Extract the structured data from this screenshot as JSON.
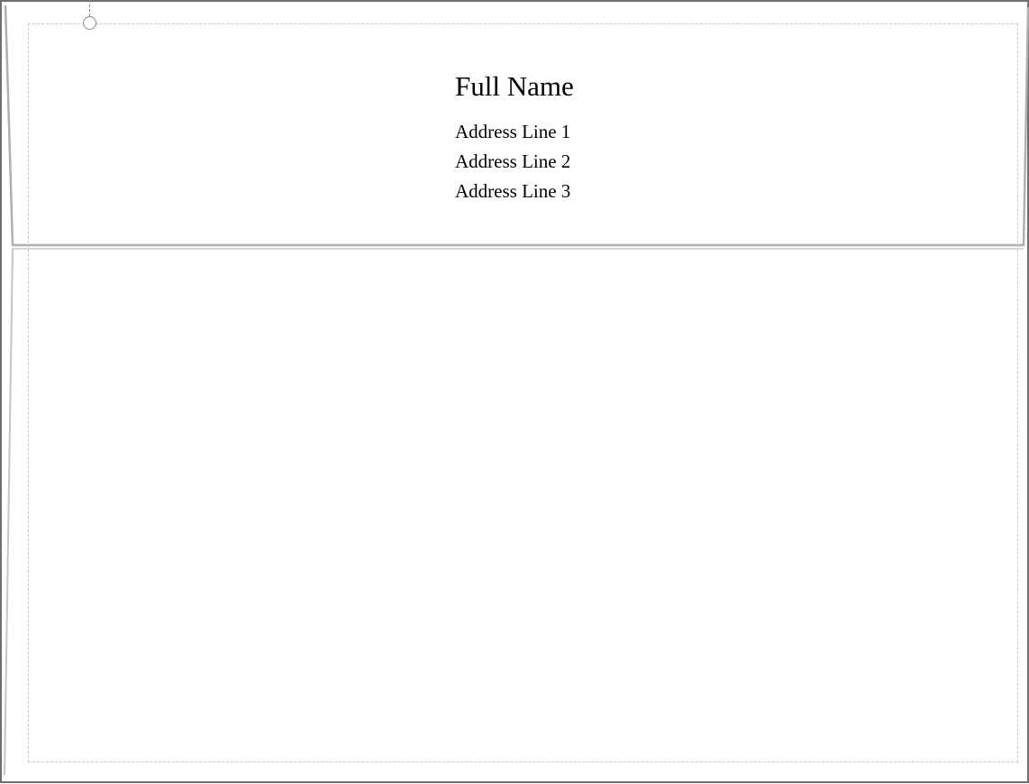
{
  "recipient": {
    "full_name": "Full Name",
    "address_lines": [
      "Address Line 1",
      "Address Line 2",
      "Address Line 3"
    ]
  },
  "colors": {
    "envelope_outline": "#6f6f6f",
    "flap_fold_line": "#b0b0b0",
    "safe_area_dashes": "#c8c8c8",
    "handle": "#8a8a8a",
    "text": "#000000"
  },
  "icons": {
    "rotate_handle": "rotate-handle-icon"
  }
}
